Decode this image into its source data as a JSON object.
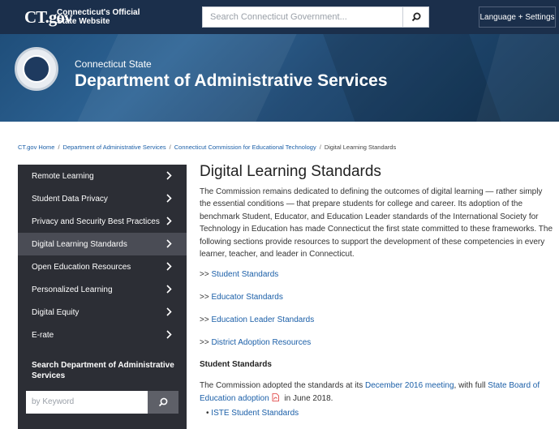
{
  "header": {
    "logo_text": "CT.gov",
    "logo_sub_line1": "Connecticut's Official",
    "logo_sub_line2": "State Website",
    "search_placeholder": "Search Connecticut Government...",
    "language_button": "Language + Settings",
    "colors": {
      "bar": "#1b2f4b",
      "banner": "#244d76"
    }
  },
  "banner": {
    "state_label": "Connecticut State",
    "department_title": "Department of Administrative Services",
    "seal_icon": "state-seal-icon"
  },
  "breadcrumb": [
    {
      "label": "CT.gov Home",
      "link": true
    },
    {
      "label": "Department of Administrative Services",
      "link": true
    },
    {
      "label": "Connecticut Commission for Educational Technology",
      "link": true
    },
    {
      "label": "Digital Learning Standards",
      "link": false
    }
  ],
  "breadcrumb_separator": "/",
  "sidebar": {
    "items": [
      {
        "label": "Remote Learning",
        "active": false
      },
      {
        "label": "Student Data Privacy",
        "active": false
      },
      {
        "label": "Privacy and Security Best Practices",
        "active": false
      },
      {
        "label": "Digital Learning Standards",
        "active": true
      },
      {
        "label": "Open Education Resources",
        "active": false
      },
      {
        "label": "Personalized Learning",
        "active": false
      },
      {
        "label": "Digital Equity",
        "active": false
      },
      {
        "label": "E-rate",
        "active": false
      }
    ],
    "search_label": "Search Department of Administrative Services",
    "search_placeholder": "by Keyword"
  },
  "main": {
    "title": "Digital Learning Standards",
    "intro": "The Commission remains dedicated to defining the outcomes of digital learning — rather simply the essential conditions — that prepare students for college and career. Its adoption of the benchmark Student, Educator, and Education Leader standards of the International Society for Technology in Education has made Connecticut the first state committed to these frameworks. The following sections provide resources to support the development of these competencies in every learner, teacher, and leader in Connecticut.",
    "links": [
      {
        "prefix": ">>",
        "label": "Student Standards"
      },
      {
        "prefix": ">>",
        "label": "Educator Standards"
      },
      {
        "prefix": ">>",
        "label": "Education Leader Standards"
      },
      {
        "prefix": ">>",
        "label": "District Adoption Resources"
      }
    ],
    "section_heading": "Student Standards",
    "para_part1": "The Commission adopted the standards at its ",
    "para_link1": "December 2016 meeting",
    "para_part2": ", with full ",
    "para_link2": "State Board of Education adoption",
    "para_part3": " in June 2018.",
    "bullet": "ISTE Student Standards"
  }
}
